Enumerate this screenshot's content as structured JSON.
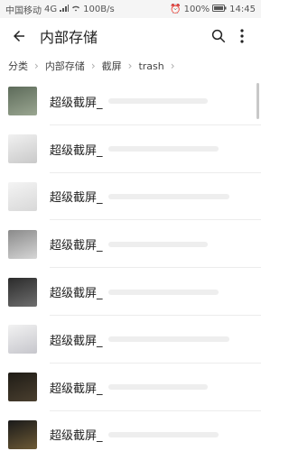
{
  "status_bar": {
    "carrier": "中国移动",
    "network": "4G",
    "speed": "100B/s",
    "battery": "100%",
    "time": "14:45"
  },
  "app_bar": {
    "title": "内部存储"
  },
  "breadcrumb": [
    "分类",
    "内部存储",
    "截屏",
    "trash"
  ],
  "files": [
    {
      "name": "超级截屏_",
      "thumb_colors": [
        "#5d6b5a",
        "#9aa691"
      ]
    },
    {
      "name": "超级截屏_",
      "thumb_colors": [
        "#f1f1f1",
        "#c9c9c9"
      ]
    },
    {
      "name": "超级截屏_",
      "thumb_colors": [
        "#f4f4f4",
        "#d8d8d8"
      ]
    },
    {
      "name": "超级截屏_",
      "thumb_colors": [
        "#8a8a8a",
        "#d6d6d6"
      ]
    },
    {
      "name": "超级截屏_",
      "thumb_colors": [
        "#2b2b2b",
        "#6e6e6e"
      ]
    },
    {
      "name": "超级截屏_",
      "thumb_colors": [
        "#f2f2f2",
        "#c6c6cc"
      ]
    },
    {
      "name": "超级截屏_",
      "thumb_colors": [
        "#1f1c16",
        "#4a3f2f"
      ]
    },
    {
      "name": "超级截屏_",
      "thumb_colors": [
        "#1a1a1a",
        "#6d5a35"
      ]
    }
  ]
}
